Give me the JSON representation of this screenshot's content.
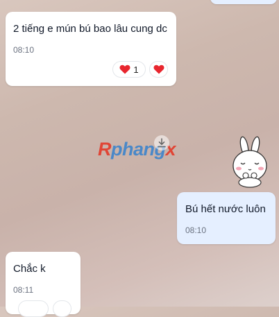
{
  "messages": [
    {
      "text": "2 tiếng e mún bú bao lâu cung dc",
      "time": "08:10",
      "reaction_count": "1"
    },
    {
      "text": "Bú hết nước luôn",
      "time": "08:10"
    },
    {
      "text": "Chắc k",
      "time": "08:11"
    }
  ],
  "watermark": {
    "r": "R",
    "middle": "phang",
    "x": "x"
  },
  "icons": {
    "reaction": "heart-icon",
    "download": "download-icon",
    "sticker": "bunny-sticker"
  },
  "colors": {
    "my_bubble": "#e5efff",
    "their_bubble": "#ffffff",
    "heart": "#e8262e"
  }
}
